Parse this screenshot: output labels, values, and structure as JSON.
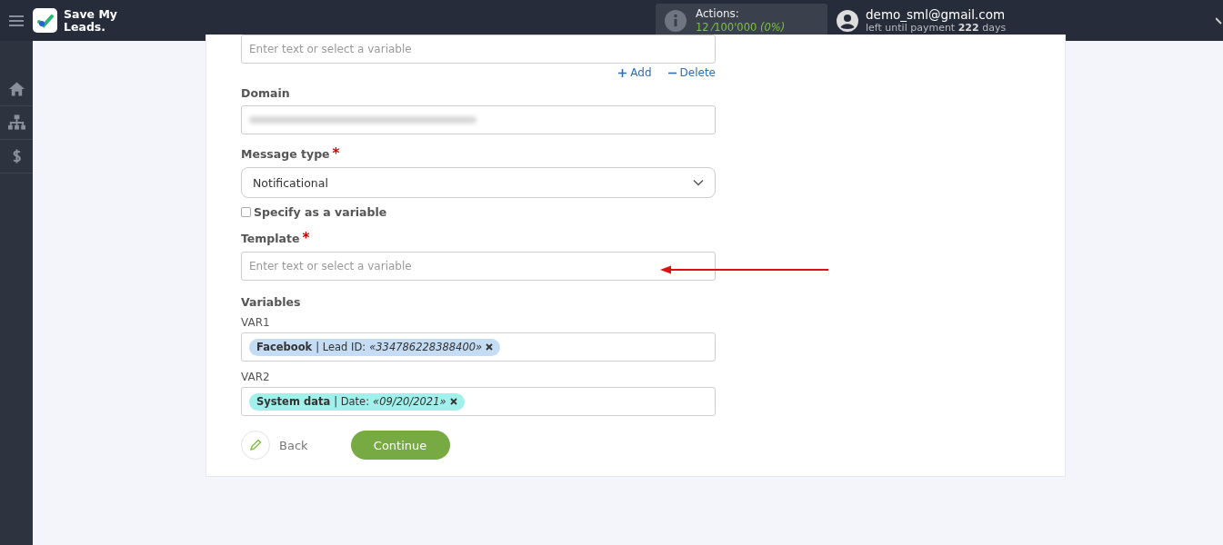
{
  "header": {
    "brand": "Save My Leads.",
    "actions": {
      "label": "Actions:",
      "usage": "12 ⁄100'000 *(0%)*"
    },
    "user": {
      "email": "demo_sml@gmail.com",
      "payment": "left until payment **222** days"
    }
  },
  "sidebar": {
    "items": [
      {
        "kind": "home"
      },
      {
        "kind": "structure"
      },
      {
        "kind": "billing"
      }
    ]
  },
  "form": {
    "top_field": {
      "placeholder": "Enter text or select a variable"
    },
    "links": [
      {
        "kind": "add",
        "label": "Add"
      },
      {
        "kind": "delete",
        "label": "Delete"
      }
    ],
    "domain": {
      "label": "Domain"
    },
    "message_type": {
      "label": "Message type",
      "required_mark": "*",
      "value": "Notificational",
      "specify_label": "Specify as a variable",
      "checked": false
    },
    "template": {
      "label": "Template",
      "required_mark": "*",
      "placeholder": "Enter text or select a variable"
    },
    "variables": {
      "title": "Variables",
      "items": [
        {
          "name": "VAR1",
          "tag": "**Facebook** | Lead ID: *«334786228388400»*",
          "color": "#c5dcf5"
        },
        {
          "name": "VAR2",
          "tag": "**System data** | Date: *«09/20/2021»*",
          "color": "#a2f0ec"
        }
      ]
    },
    "back": "Back",
    "continue": "Continue"
  }
}
